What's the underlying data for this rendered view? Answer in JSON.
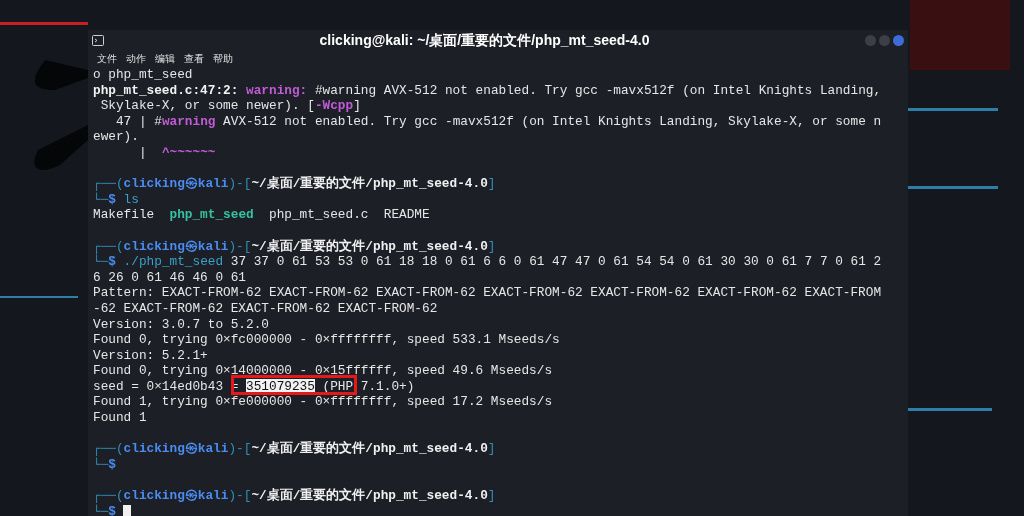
{
  "window": {
    "title": "clicking@kali: ~/桌面/重要的文件/php_mt_seed-4.0"
  },
  "menu": [
    "文件",
    "动作",
    "编辑",
    "查看",
    "帮助"
  ],
  "terminal": {
    "cursor_visible": true,
    "lines": [
      {
        "kind": "text",
        "segments": [
          {
            "kind": "plain",
            "text": "o php_mt_seed"
          }
        ]
      },
      {
        "kind": "text",
        "segments": [
          {
            "kind": "bold",
            "text": "php_mt_seed.c:47:2: "
          },
          {
            "kind": "warning",
            "text": "warning:"
          },
          {
            "kind": "plain",
            "text": " #warning AVX-512 not enabled. Try gcc -mavx512f (on Intel Knights Landing,"
          }
        ]
      },
      {
        "kind": "text",
        "segments": [
          {
            "kind": "plain",
            "text": " Skylake-X, or some newer). ["
          },
          {
            "kind": "warning",
            "text": "-Wcpp"
          },
          {
            "kind": "plain",
            "text": "]"
          }
        ]
      },
      {
        "kind": "text",
        "segments": [
          {
            "kind": "plain",
            "text": "   47 | #"
          },
          {
            "kind": "warning",
            "text": "warning"
          },
          {
            "kind": "plain",
            "text": " AVX-512 not enabled. Try gcc -mavx512f (on Intel Knights Landing, Skylake-X, or some n"
          }
        ]
      },
      {
        "kind": "text",
        "segments": [
          {
            "kind": "plain",
            "text": "ewer)."
          }
        ]
      },
      {
        "kind": "text",
        "segments": [
          {
            "kind": "plain",
            "text": "      |  "
          },
          {
            "kind": "warning",
            "text": "^~~~~~~"
          }
        ]
      },
      {
        "kind": "blank"
      },
      {
        "kind": "text",
        "segments": [
          {
            "kind": "frame",
            "text": "┌──("
          },
          {
            "kind": "host",
            "text": "clicking㉿kali"
          },
          {
            "kind": "frame",
            "text": ")-["
          },
          {
            "kind": "path",
            "text": "~/桌面/重要的文件/php_mt_seed-4.0"
          },
          {
            "kind": "frame",
            "text": "]"
          }
        ]
      },
      {
        "kind": "text",
        "segments": [
          {
            "kind": "frame",
            "text": "└─"
          },
          {
            "kind": "host",
            "text": "$"
          },
          {
            "kind": "command",
            "text": " ls"
          }
        ]
      },
      {
        "kind": "text",
        "segments": [
          {
            "kind": "plain",
            "text": "Makefile  "
          },
          {
            "kind": "exec",
            "text": "php_mt_seed"
          },
          {
            "kind": "plain",
            "text": "  php_mt_seed.c  README"
          }
        ]
      },
      {
        "kind": "blank"
      },
      {
        "kind": "text",
        "segments": [
          {
            "kind": "frame",
            "text": "┌──("
          },
          {
            "kind": "host",
            "text": "clicking㉿kali"
          },
          {
            "kind": "frame",
            "text": ")-["
          },
          {
            "kind": "path",
            "text": "~/桌面/重要的文件/php_mt_seed-4.0"
          },
          {
            "kind": "frame",
            "text": "]"
          }
        ]
      },
      {
        "kind": "text",
        "segments": [
          {
            "kind": "frame",
            "text": "└─"
          },
          {
            "kind": "host",
            "text": "$"
          },
          {
            "kind": "command",
            "text": " ./php_mt_seed"
          },
          {
            "kind": "plain",
            "text": " 37 37 0 61 53 53 0 61 18 18 0 61 6 6 0 61 47 47 0 61 54 54 0 61 30 30 0 61 7 7 0 61 2"
          }
        ]
      },
      {
        "kind": "text",
        "segments": [
          {
            "kind": "plain",
            "text": "6 26 0 61 46 46 0 61"
          }
        ]
      },
      {
        "kind": "text",
        "segments": [
          {
            "kind": "plain",
            "text": "Pattern: EXACT-FROM-62 EXACT-FROM-62 EXACT-FROM-62 EXACT-FROM-62 EXACT-FROM-62 EXACT-FROM-62 EXACT-FROM"
          }
        ]
      },
      {
        "kind": "text",
        "segments": [
          {
            "kind": "plain",
            "text": "-62 EXACT-FROM-62 EXACT-FROM-62 EXACT-FROM-62"
          }
        ]
      },
      {
        "kind": "text",
        "segments": [
          {
            "kind": "plain",
            "text": "Version: 3.0.7 to 5.2.0"
          }
        ]
      },
      {
        "kind": "text",
        "segments": [
          {
            "kind": "plain",
            "text": "Found 0, trying 0×fc000000 - 0×ffffffff, speed 533.1 Mseeds/s"
          }
        ]
      },
      {
        "kind": "text",
        "segments": [
          {
            "kind": "plain",
            "text": "Version: 5.2.1+"
          }
        ]
      },
      {
        "kind": "text",
        "segments": [
          {
            "kind": "plain",
            "text": "Found 0, trying 0×14000000 - 0×15ffffff, speed 49.6 Mseeds/s"
          }
        ]
      },
      {
        "kind": "text",
        "segments": [
          {
            "kind": "plain",
            "text": "seed = 0×14ed0b43 = "
          },
          {
            "kind": "selected",
            "text": "351079235"
          },
          {
            "kind": "plain",
            "text": " (PHP 7.1.0+)"
          }
        ]
      },
      {
        "kind": "text",
        "segments": [
          {
            "kind": "plain",
            "text": "Found 1, trying 0×fe000000 - 0×ffffffff, speed 17.2 Mseeds/s"
          }
        ]
      },
      {
        "kind": "text",
        "segments": [
          {
            "kind": "plain",
            "text": "Found 1"
          }
        ]
      },
      {
        "kind": "blank"
      },
      {
        "kind": "text",
        "segments": [
          {
            "kind": "frame",
            "text": "┌──("
          },
          {
            "kind": "host",
            "text": "clicking㉿kali"
          },
          {
            "kind": "frame",
            "text": ")-["
          },
          {
            "kind": "path",
            "text": "~/桌面/重要的文件/php_mt_seed-4.0"
          },
          {
            "kind": "frame",
            "text": "]"
          }
        ]
      },
      {
        "kind": "text",
        "segments": [
          {
            "kind": "frame",
            "text": "└─"
          },
          {
            "kind": "host",
            "text": "$"
          }
        ]
      },
      {
        "kind": "blank"
      },
      {
        "kind": "text",
        "segments": [
          {
            "kind": "frame",
            "text": "┌──("
          },
          {
            "kind": "host",
            "text": "clicking㉿kali"
          },
          {
            "kind": "frame",
            "text": ")-["
          },
          {
            "kind": "path",
            "text": "~/桌面/重要的文件/php_mt_seed-4.0"
          },
          {
            "kind": "frame",
            "text": "]"
          }
        ]
      },
      {
        "kind": "text",
        "segments": [
          {
            "kind": "frame",
            "text": "└─"
          },
          {
            "kind": "host",
            "text": "$"
          }
        ]
      }
    ]
  }
}
